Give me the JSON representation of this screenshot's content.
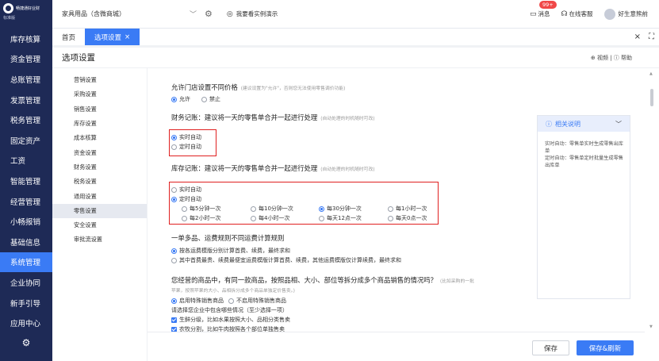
{
  "app": {
    "logo_name": "畅捷通好业财",
    "logo_sub": "标准版"
  },
  "sidebar": {
    "items": [
      {
        "label": "库存核算"
      },
      {
        "label": "资金管理"
      },
      {
        "label": "总账管理"
      },
      {
        "label": "发票管理"
      },
      {
        "label": "税务管理"
      },
      {
        "label": "固定资产"
      },
      {
        "label": "工资"
      },
      {
        "label": "智能管理"
      },
      {
        "label": "经营管理"
      },
      {
        "label": "小畅报销"
      },
      {
        "label": "基础信息"
      },
      {
        "label": "系统管理",
        "active": true
      },
      {
        "label": "企业协同"
      },
      {
        "label": "新手引导"
      },
      {
        "label": "应用中心"
      }
    ],
    "gear_icon": "gear-icon"
  },
  "topbar": {
    "store": "家具用品（含微商城）",
    "demo_link": "我要看实例演示",
    "message_label": "消息",
    "message_badge": "99+",
    "service_label": "在线客服",
    "user_name": "好生意熊前"
  },
  "tabs": [
    {
      "label": "首页"
    },
    {
      "label": "选项设置",
      "active": true,
      "close": "×"
    }
  ],
  "tab_tools": {
    "close": "×",
    "expand": "⛶"
  },
  "page": {
    "title": "选项设置",
    "help_links": "⊕ 视频 | ⓘ 帮助"
  },
  "subnav": {
    "items": [
      {
        "label": "营销设置"
      },
      {
        "label": "采购设置"
      },
      {
        "label": "销售设置"
      },
      {
        "label": "库存设置"
      },
      {
        "label": "成本核算"
      },
      {
        "label": "资金设置"
      },
      {
        "label": "财务设置"
      },
      {
        "label": "税务设置"
      },
      {
        "label": "通用设置"
      },
      {
        "label": "零售设置",
        "active": true
      },
      {
        "label": "安全设置"
      },
      {
        "label": "审批流设置"
      }
    ]
  },
  "settings": {
    "price": {
      "title": "允许门店设置不同价格",
      "hint": "(建议设置为\"允许\"，否则您无法使用零售调价功能)",
      "options": [
        "允许",
        "禁止"
      ],
      "selected": 0
    },
    "finance": {
      "title": "财务记账：建议将一天的零售单合并一起进行处理",
      "hint": "(自动处理的时机随时可改)",
      "options": [
        "实时自动",
        "定时自动"
      ],
      "selected": 0
    },
    "stock": {
      "title": "库存记账：建议将一天的零售单合并一起进行处理",
      "hint": "(自动处理的时机随时可改)",
      "options": [
        "实时自动",
        "定时自动"
      ],
      "selected": 1,
      "timing": [
        "每5分钟一次",
        "每10分钟一次",
        "每30分钟一次",
        "每1小时一次",
        "每2小时一次",
        "每4小时一次",
        "每天12点一次",
        "每天0点一次"
      ],
      "timing_selected": 2
    },
    "freight": {
      "title": "一单多品、运费规则不同运费计算规则",
      "options": [
        "按各运费模版分别计算首费、续费，最终求和",
        "其中首费最贵、续费最便宜运费模版计算首费、续费，其他运费模版仅计算续费，最终求和"
      ],
      "selected": 0
    },
    "split": {
      "title": "您经营的商品中，有同一款商品，按照品相、大小、部位等拆分成多个商品销售的情况吗？",
      "hint_line1": "(比如采购的一批",
      "hint_line2": "苹果，按照苹果的大小、品相拆分成多个商品单独定价售卖。)",
      "options": [
        "启用特殊销售商品",
        "不启用特殊销售商品"
      ],
      "selected": 0,
      "sub_title": "请选择您企业中包含哪些情况（至少选择一项）",
      "checks": [
        "生鲜分级，比如水果按照大小、品相分类售卖",
        "农牧分割，比如牛肉按照各个部位单独售卖"
      ]
    }
  },
  "help_card": {
    "title": "相关说明",
    "line1": "实时自动：零售单实时生成零售出库单",
    "line2": "定时自动：零售单定时批量生成零售出库单"
  },
  "footer": {
    "save": "保存",
    "save_refresh": "保存&刷新"
  }
}
